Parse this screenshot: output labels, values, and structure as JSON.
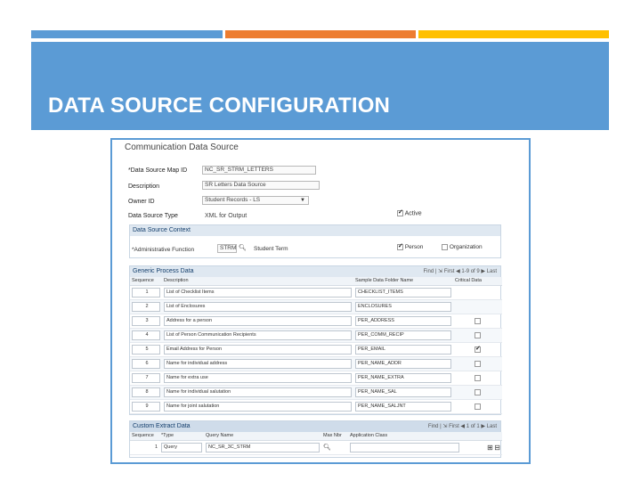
{
  "slide": {
    "title": "DATA SOURCE CONFIGURATION"
  },
  "page": {
    "title": "Communication Data Source",
    "fields": {
      "map_id_label": "*Data Source Map ID",
      "map_id_value": "NC_SR_STRM_LETTERS",
      "description_label": "Description",
      "description_value": "SR Letters Data Source",
      "owner_label": "Owner ID",
      "owner_value": "Student Records - LS",
      "type_label": "Data Source Type",
      "type_value": "XML for Output",
      "active_label": "Active",
      "active_checked": true
    },
    "context": {
      "title": "Data Source Context",
      "admin_func_label": "*Administrative Function",
      "admin_func_value": "STRM",
      "admin_func_desc": "Student Term",
      "person_label": "Person",
      "person_checked": true,
      "org_label": "Organization",
      "org_checked": false
    },
    "generic": {
      "title": "Generic Process Data",
      "nav": "Find | ⇲    First  ◀  1-9 of 9  ▶  Last",
      "columns": [
        "Sequence",
        "Description",
        "Sample Data Folder Name",
        "Critical Data"
      ],
      "rows": [
        {
          "seq": "1",
          "desc": "List of Checklist Items",
          "folder": "CHECKLIST_ITEMS",
          "crit": null
        },
        {
          "seq": "2",
          "desc": "List of Enclosures",
          "folder": "ENCLOSURES",
          "crit": null
        },
        {
          "seq": "3",
          "desc": "Address for a person",
          "folder": "PER_ADDRESS",
          "crit": false
        },
        {
          "seq": "4",
          "desc": "List of Person Communication Recipients",
          "folder": "PER_COMM_RECIP",
          "crit": false
        },
        {
          "seq": "5",
          "desc": "Email Address for Person",
          "folder": "PER_EMAIL",
          "crit": true
        },
        {
          "seq": "6",
          "desc": "Name for individual address",
          "folder": "PER_NAME_ADDR",
          "crit": false
        },
        {
          "seq": "7",
          "desc": "Name for extra use",
          "folder": "PER_NAME_EXTRA",
          "crit": false
        },
        {
          "seq": "8",
          "desc": "Name for individual salutation",
          "folder": "PER_NAME_SAL",
          "crit": false
        },
        {
          "seq": "9",
          "desc": "Name for joint salutation",
          "folder": "PER_NAME_SALJNT",
          "crit": false
        }
      ]
    },
    "custom": {
      "title": "Custom Extract Data",
      "nav": "Find | ⇲    First  ◀  1 of 1  ▶  Last",
      "columns": [
        "Sequence",
        "*Type",
        "Query Name",
        "Max Nbr",
        "Application Class"
      ],
      "row": {
        "seq": "1",
        "type": "Query",
        "query": "NC_SR_3C_STRM",
        "max": "",
        "app_class": ""
      }
    }
  },
  "colors": {
    "banner": "#5b9bd5",
    "stripe_orange": "#ed7d31",
    "stripe_gold": "#ffc000"
  }
}
